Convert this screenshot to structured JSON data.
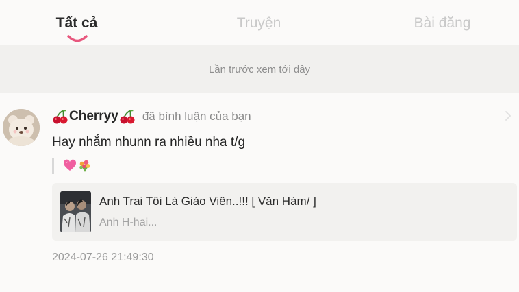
{
  "tabs": [
    {
      "label": "Tất cả",
      "active": true
    },
    {
      "label": "Truyện",
      "active": false
    },
    {
      "label": "Bài đăng",
      "active": false
    }
  ],
  "divider": {
    "label": "Lần trước xem tới đây"
  },
  "notification": {
    "user": {
      "name": "Cherryy",
      "decoration_icon": "cherry-icon"
    },
    "action": "đã bình luận của bạn",
    "comment": "Hay nhắm nhunn ra nhiều nha t/g",
    "quoted_reply_icons": [
      "pink-heart-icon",
      "bouquet-icon"
    ],
    "story": {
      "title": "Anh Trai Tôi Là Giáo Viên..!!! [ Văn Hàm/ ]",
      "excerpt": "Anh H-hai..."
    },
    "timestamp": "2024-07-26 21:49:30"
  },
  "colors": {
    "background": "#fbfaf9",
    "divider_band": "#f1f0ee",
    "accent_indicator": "#e8577e",
    "card_background": "#f2f1ef"
  }
}
